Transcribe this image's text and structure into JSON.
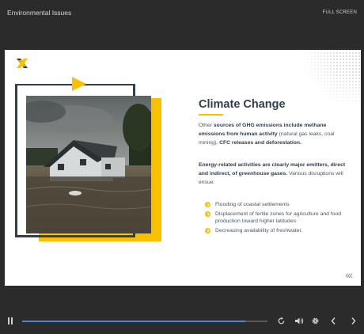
{
  "topbar": {
    "title": "Environmental Issues",
    "fullscreen_label": "FULL SCREEN"
  },
  "slide": {
    "heading": "Climate Change",
    "p1": {
      "a": "Other ",
      "b1": "sources of GHG emissions include methane emissions from human activity",
      "c": " (natural gas leaks, coal mining), ",
      "b2": "CFC releases and deforestation."
    },
    "p2": {
      "b1": "Energy-related activities are clearly major emitters, direct and indirect, of greenhouse gases.",
      "c": " Various disruptions will ensue:"
    },
    "bullets": [
      "Flooding of coastal settlements",
      "Displacement of fertile zones for agriculture and food production toward higher latitudes",
      "Decreasing availability of freshwater."
    ],
    "nav_label": "‹‹‹"
  },
  "controls": {
    "progress": 0.91
  },
  "colors": {
    "accent": "#f7c100",
    "navy": "#2f3e50",
    "progress": "#4f86c7"
  }
}
